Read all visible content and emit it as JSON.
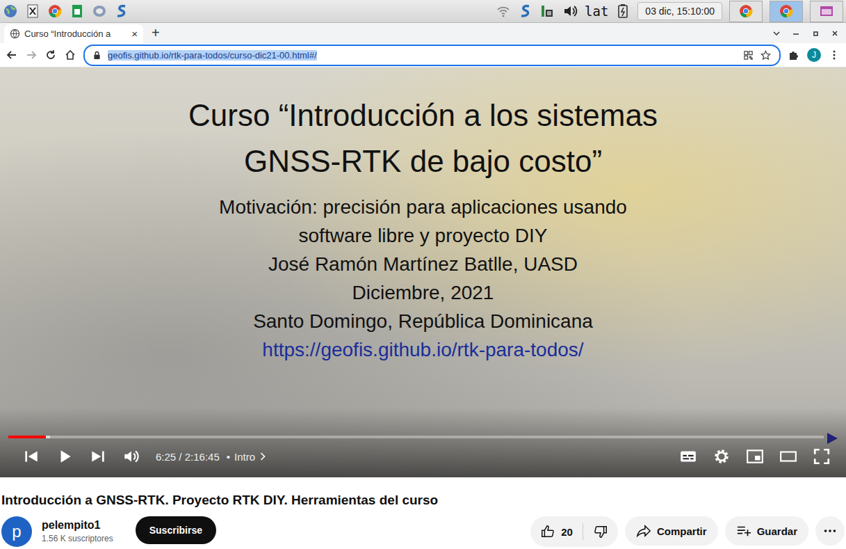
{
  "taskbar": {
    "language": "lat",
    "clock": "03 dic, 15:10:00"
  },
  "browser": {
    "tabs": [
      {
        "label": "Curso “Introducción a",
        "close": "×",
        "selected": true
      }
    ],
    "new_tab": "+",
    "url": "geofis.github.io/rtk-para-todos/curso-dic21-00.html#/",
    "url_selected": true,
    "profile_initial": "J"
  },
  "slide": {
    "title_lines": [
      "Curso “Introducción a los sistemas",
      "GNSS-RTK de bajo costo”"
    ],
    "lines": [
      "Motivación: precisión para aplicaciones usando",
      "software libre y proyecto DIY",
      "José Ramón Martínez Batlle, UASD",
      "Diciembre, 2021",
      "Santo Domingo, República Dominicana"
    ],
    "link": "https://geofis.github.io/rtk-para-todos/"
  },
  "player": {
    "progress": 0.046,
    "buffered": 0.051,
    "playing": false,
    "time": "6:25 / 2:16:45",
    "chapter_separator": "•",
    "chapter": "Intro"
  },
  "video": {
    "title": "Introducción a GNSS-RTK. Proyecto RTK DIY. Herramientas del curso",
    "channel": {
      "initial": "p",
      "name": "pelempito1",
      "subscribers": "1.56 K suscriptores"
    },
    "subscribe": "Suscribirse",
    "likes": "20",
    "share": "Compartir",
    "save": "Guardar"
  }
}
